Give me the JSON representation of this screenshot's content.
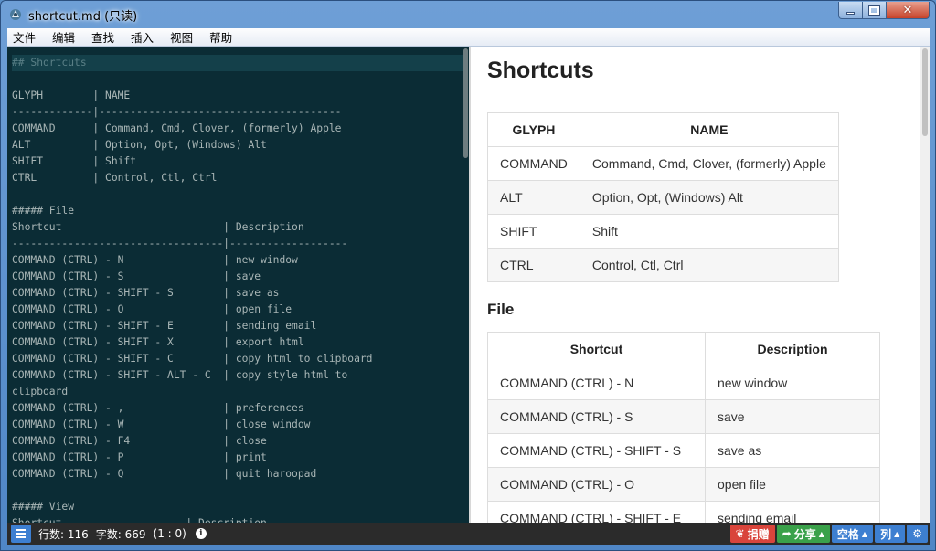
{
  "window": {
    "title": "shortcut.md (只读)"
  },
  "menu": [
    "文件",
    "编辑",
    "查找",
    "插入",
    "视图",
    "帮助"
  ],
  "editor": {
    "lines": [
      "## Shortcuts",
      "",
      "GLYPH        | NAME",
      "-------------|---------------------------------------",
      "COMMAND      | Command, Cmd, Clover, (formerly) Apple",
      "ALT          | Option, Opt, (Windows) Alt",
      "SHIFT        | Shift",
      "CTRL         | Control, Ctl, Ctrl",
      "",
      "##### File",
      "Shortcut                          | Description",
      "----------------------------------|-------------------",
      "COMMAND (CTRL) - N                | new window",
      "COMMAND (CTRL) - S                | save",
      "COMMAND (CTRL) - SHIFT - S        | save as",
      "COMMAND (CTRL) - O                | open file",
      "COMMAND (CTRL) - SHIFT - E        | sending email",
      "COMMAND (CTRL) - SHIFT - X        | export html",
      "COMMAND (CTRL) - SHIFT - C        | copy html to clipboard",
      "COMMAND (CTRL) - SHIFT - ALT - C  | copy style html to",
      "clipboard",
      "COMMAND (CTRL) - ,                | preferences",
      "COMMAND (CTRL) - W                | close window",
      "COMMAND (CTRL) - F4               | close",
      "COMMAND (CTRL) - P                | print",
      "COMMAND (CTRL) - Q                | quit haroopad",
      "",
      "##### View",
      "Shortcut                    | Description"
    ]
  },
  "preview": {
    "heading": "Shortcuts",
    "table1": {
      "headers": [
        "GLYPH",
        "NAME"
      ],
      "rows": [
        [
          "COMMAND",
          "Command, Cmd, Clover, (formerly) Apple"
        ],
        [
          "ALT",
          "Option, Opt, (Windows) Alt"
        ],
        [
          "SHIFT",
          "Shift"
        ],
        [
          "CTRL",
          "Control, Ctl, Ctrl"
        ]
      ]
    },
    "section_file": "File",
    "table2": {
      "headers": [
        "Shortcut",
        "Description"
      ],
      "rows": [
        [
          "COMMAND (CTRL) - N",
          "new window"
        ],
        [
          "COMMAND (CTRL) - S",
          "save"
        ],
        [
          "COMMAND (CTRL) - SHIFT - S",
          "save as"
        ],
        [
          "COMMAND (CTRL) - O",
          "open file"
        ],
        [
          "COMMAND (CTRL) - SHIFT - E",
          "sending email"
        ]
      ]
    }
  },
  "status": {
    "lines": "行数: 116",
    "chars": "字数: 669",
    "cursor": "(1 : 0)",
    "donate": "捐赠",
    "share": "分享",
    "indent": "空格",
    "column": "列"
  }
}
